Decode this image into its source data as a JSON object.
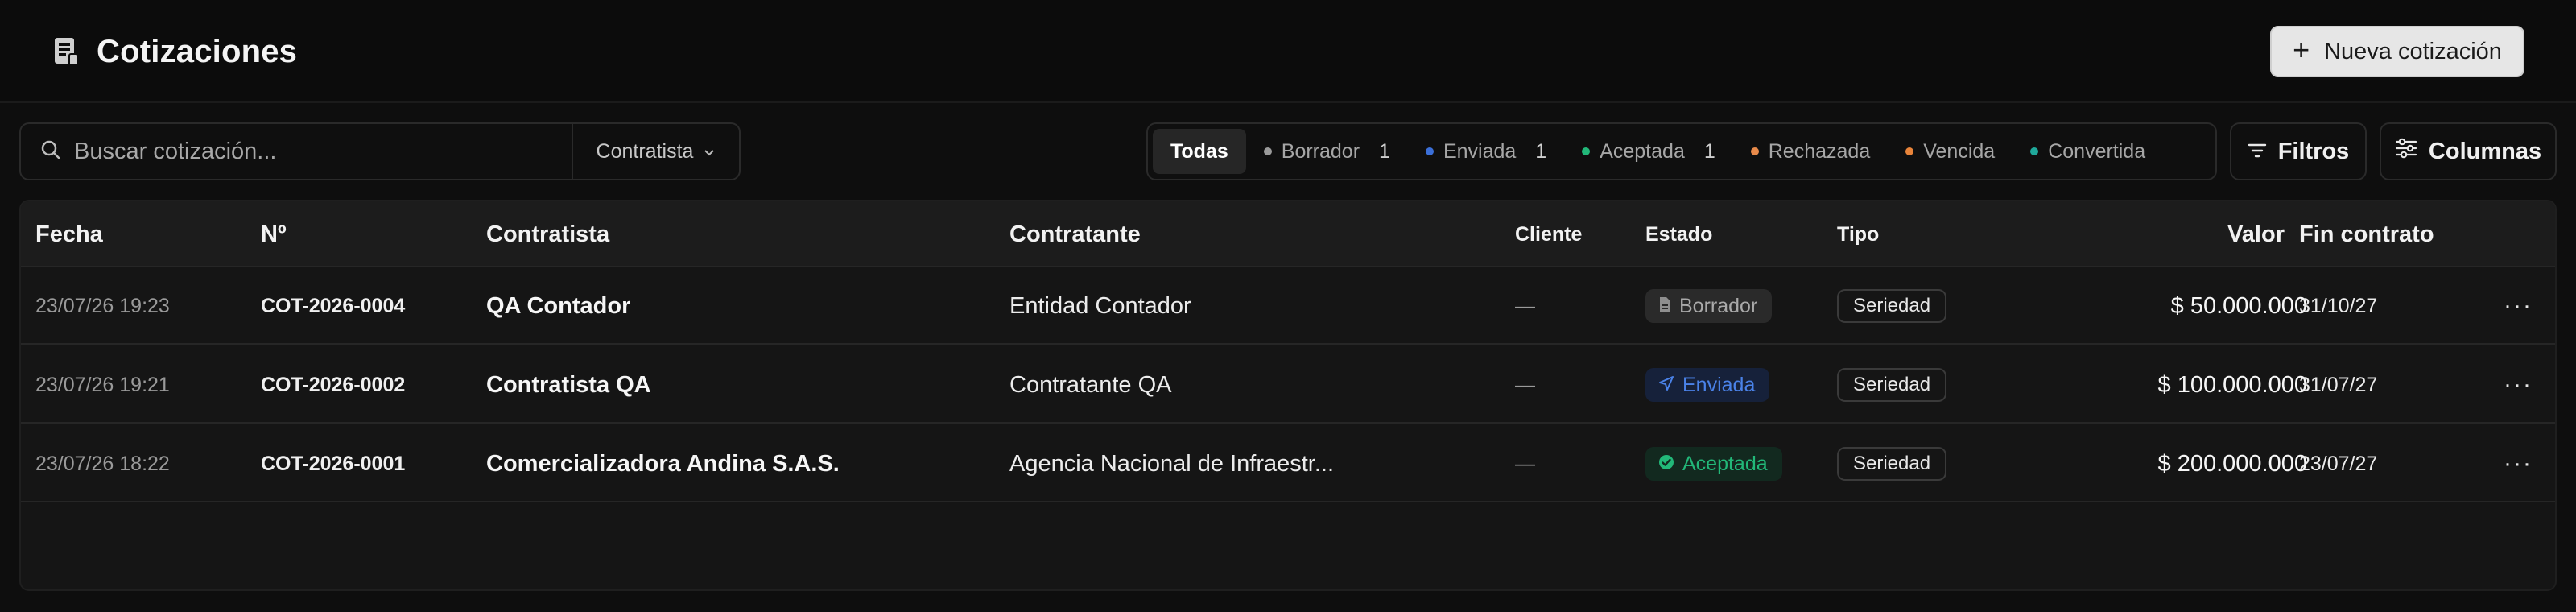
{
  "header": {
    "title": "Cotizaciones",
    "title_icon": "document-icon",
    "new_button_label": "Nueva cotización"
  },
  "toolbar": {
    "search_placeholder": "Buscar cotización...",
    "search_value": "",
    "contratista_select": "Contratista",
    "status_tabs": [
      {
        "label": "Todas",
        "count": "",
        "dot_color": "",
        "active": true
      },
      {
        "label": "Borrador",
        "count": "1",
        "dot_color": "#9a9a9a"
      },
      {
        "label": "Enviada",
        "count": "1",
        "dot_color": "#3b6fd8"
      },
      {
        "label": "Aceptada",
        "count": "1",
        "dot_color": "#22b879"
      },
      {
        "label": "Rechazada",
        "count": "",
        "dot_color": "#e88a4a"
      },
      {
        "label": "Vencida",
        "count": "",
        "dot_color": "#e8843a"
      },
      {
        "label": "Convertida",
        "count": "",
        "dot_color": "#1fa89a"
      }
    ],
    "filtros_label": "Filtros",
    "columnas_label": "Columnas"
  },
  "table": {
    "columns": {
      "fecha": "Fecha",
      "numero": "Nº",
      "contratista": "Contratista",
      "contratante": "Contratante",
      "cliente": "Cliente",
      "estado": "Estado",
      "tipo": "Tipo",
      "valor": "Valor",
      "fin_contrato": "Fin contrato"
    },
    "rows": [
      {
        "fecha": "23/07/26 19:23",
        "numero": "COT-2026-0004",
        "contratista": "QA Contador",
        "contratante": "Entidad Contador",
        "cliente": "—",
        "estado": "Borrador",
        "tipo": "Seriedad",
        "valor": "$ 50.000.000",
        "fin_contrato": "31/10/27",
        "more": "···"
      },
      {
        "fecha": "23/07/26 19:21",
        "numero": "COT-2026-0002",
        "contratista": "Contratista QA",
        "contratante": "Contratante QA",
        "cliente": "—",
        "estado": "Enviada",
        "tipo": "Seriedad",
        "valor": "$ 100.000.000",
        "fin_contrato": "31/07/27",
        "more": "···"
      },
      {
        "fecha": "23/07/26 18:22",
        "numero": "COT-2026-0001",
        "contratista": "Comercializadora Andina S.A.S.",
        "contratante": "Agencia Nacional de Infraestr...",
        "cliente": "—",
        "estado": "Aceptada",
        "tipo": "Seriedad",
        "valor": "$ 200.000.000",
        "fin_contrato": "23/07/27",
        "more": "···"
      }
    ]
  },
  "colors": {
    "borrador": "#a9a9a9",
    "enviada": "#4a82e8",
    "aceptada": "#22b879"
  }
}
